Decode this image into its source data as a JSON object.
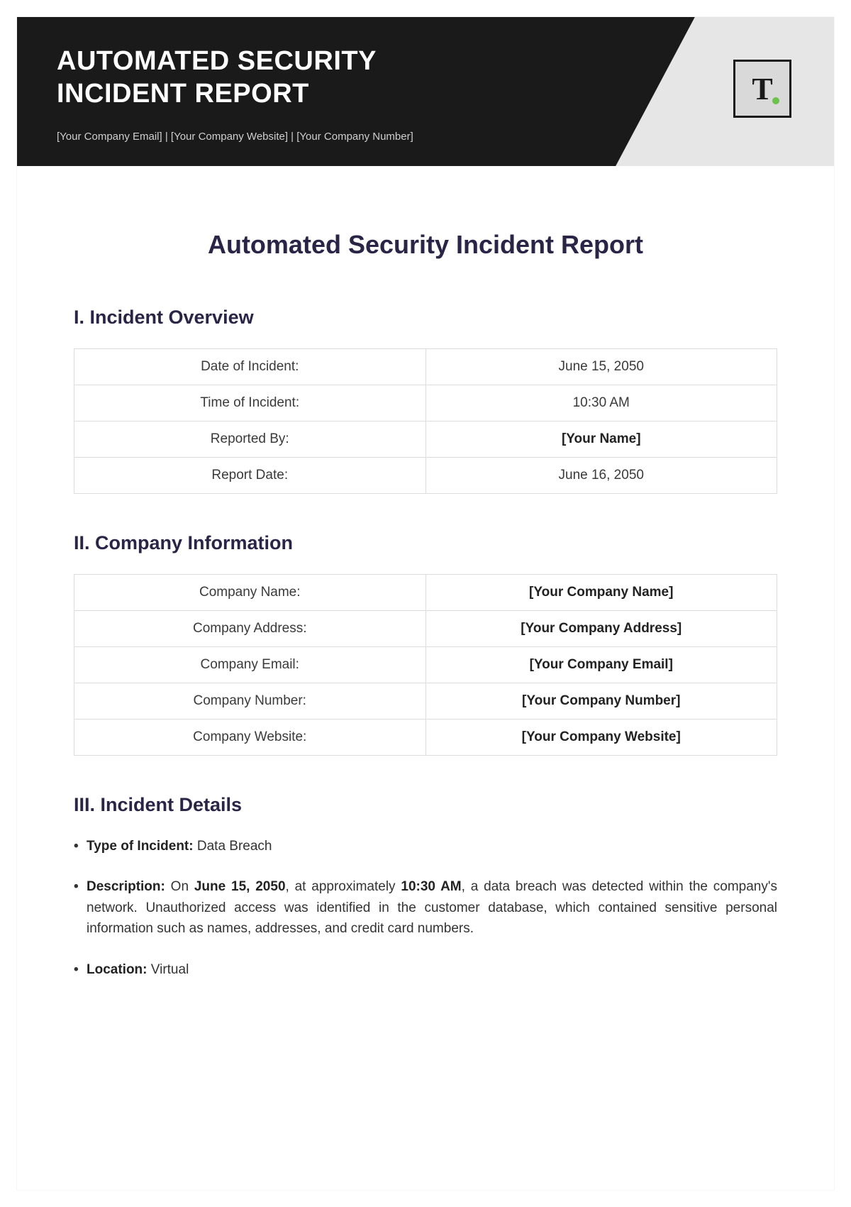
{
  "header": {
    "title_line1": "AUTOMATED SECURITY",
    "title_line2": "INCIDENT REPORT",
    "sub_email": "[Your Company Email]",
    "sub_sep1": " | ",
    "sub_website": "[Your Company Website]",
    "sub_sep2": " | ",
    "sub_number": "[Your Company Number]",
    "logo_letter": "T"
  },
  "doc_title": "Automated Security Incident Report",
  "sections": {
    "s1": {
      "heading": "I. Incident Overview",
      "rows": [
        {
          "label": "Date of Incident:",
          "value": "June 15, 2050",
          "bold": false
        },
        {
          "label": "Time of Incident:",
          "value": "10:30 AM",
          "bold": false
        },
        {
          "label": "Reported By:",
          "value": "[Your Name]",
          "bold": true
        },
        {
          "label": "Report Date:",
          "value": "June 16, 2050",
          "bold": false
        }
      ]
    },
    "s2": {
      "heading": "II. Company Information",
      "rows": [
        {
          "label": "Company Name:",
          "value": "[Your Company Name]",
          "bold": true
        },
        {
          "label": "Company Address:",
          "value": "[Your Company Address]",
          "bold": true
        },
        {
          "label": "Company Email:",
          "value": "[Your Company Email]",
          "bold": true
        },
        {
          "label": "Company Number:",
          "value": "[Your Company Number]",
          "bold": true
        },
        {
          "label": "Company Website:",
          "value": "[Your Company Website]",
          "bold": true
        }
      ]
    },
    "s3": {
      "heading": "III. Incident Details",
      "items": {
        "type_label": "Type of Incident:",
        "type_value": " Data Breach",
        "desc_label": "Description:",
        "desc_pre": " On ",
        "desc_date": "June 15, 2050",
        "desc_mid1": ", at approximately ",
        "desc_time": "10:30 AM",
        "desc_post": ", a data breach was detected within the company's network. Unauthorized access was identified in the customer database, which contained sensitive personal information such as names, addresses, and credit card numbers.",
        "loc_label": "Location:",
        "loc_value": " Virtual"
      }
    }
  }
}
